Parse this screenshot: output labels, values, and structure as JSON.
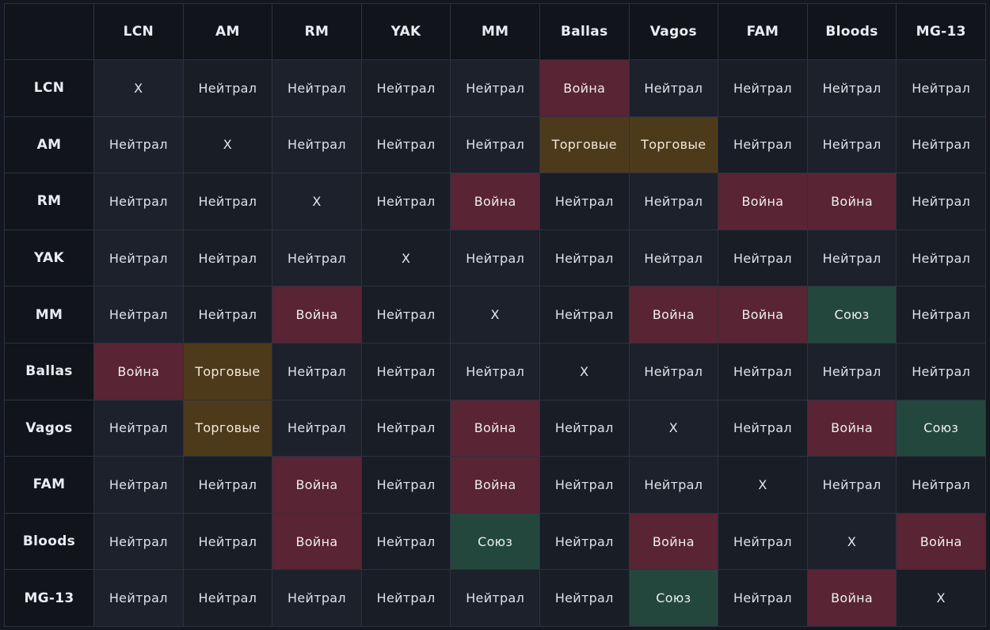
{
  "matrix": {
    "corner_label": "",
    "columns": [
      "LCN",
      "AM",
      "RM",
      "YAK",
      "MM",
      "Ballas",
      "Vagos",
      "FAM",
      "Bloods",
      "MG-13"
    ],
    "rows": [
      {
        "label": "LCN",
        "cells": [
          "X",
          "Нейтрал",
          "Нейтрал",
          "Нейтрал",
          "Нейтрал",
          "Война",
          "Нейтрал",
          "Нейтрал",
          "Нейтрал",
          "Нейтрал"
        ]
      },
      {
        "label": "AM",
        "cells": [
          "Нейтрал",
          "X",
          "Нейтрал",
          "Нейтрал",
          "Нейтрал",
          "Торговые",
          "Торговые",
          "Нейтрал",
          "Нейтрал",
          "Нейтрал"
        ]
      },
      {
        "label": "RM",
        "cells": [
          "Нейтрал",
          "Нейтрал",
          "X",
          "Нейтрал",
          "Война",
          "Нейтрал",
          "Нейтрал",
          "Война",
          "Война",
          "Нейтрал"
        ]
      },
      {
        "label": "YAK",
        "cells": [
          "Нейтрал",
          "Нейтрал",
          "Нейтрал",
          "X",
          "Нейтрал",
          "Нейтрал",
          "Нейтрал",
          "Нейтрал",
          "Нейтрал",
          "Нейтрал"
        ]
      },
      {
        "label": "MM",
        "cells": [
          "Нейтрал",
          "Нейтрал",
          "Война",
          "Нейтрал",
          "X",
          "Нейтрал",
          "Война",
          "Война",
          "Союз",
          "Нейтрал"
        ]
      },
      {
        "label": "Ballas",
        "cells": [
          "Война",
          "Торговые",
          "Нейтрал",
          "Нейтрал",
          "Нейтрал",
          "X",
          "Нейтрал",
          "Нейтрал",
          "Нейтрал",
          "Нейтрал"
        ]
      },
      {
        "label": "Vagos",
        "cells": [
          "Нейтрал",
          "Торговые",
          "Нейтрал",
          "Нейтрал",
          "Война",
          "Нейтрал",
          "X",
          "Нейтрал",
          "Война",
          "Союз"
        ]
      },
      {
        "label": "FAM",
        "cells": [
          "Нейтрал",
          "Нейтрал",
          "Война",
          "Нейтрал",
          "Война",
          "Нейтрал",
          "Нейтрал",
          "X",
          "Нейтрал",
          "Нейтрал"
        ]
      },
      {
        "label": "Bloods",
        "cells": [
          "Нейтрал",
          "Нейтрал",
          "Война",
          "Нейтрал",
          "Союз",
          "Нейтрал",
          "Война",
          "Нейтрал",
          "X",
          "Война"
        ]
      },
      {
        "label": "MG-13",
        "cells": [
          "Нейтрал",
          "Нейтрал",
          "Нейтрал",
          "Нейтрал",
          "Нейтрал",
          "Нейтрал",
          "Союз",
          "Нейтрал",
          "Война",
          "X"
        ]
      }
    ]
  },
  "colors": {
    "war": "#592433",
    "trade": "#4d3a1b",
    "ally": "#24473d",
    "neutral": "#1d212b",
    "header": "#11141b"
  }
}
